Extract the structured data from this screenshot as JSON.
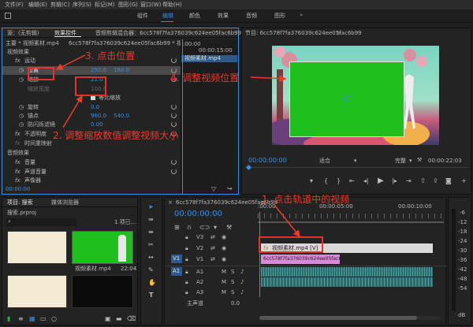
{
  "menu": [
    "文件(F)",
    "编辑(E)",
    "剪辑(C)",
    "序列(S)",
    "标记(M)",
    "图形(G)",
    "窗口(W)",
    "帮助(H)"
  ],
  "workspaces": [
    "组件",
    "编辑",
    "颜色",
    "效果",
    "音频",
    "图形"
  ],
  "effects": {
    "tabs": [
      "源：(无剪辑)",
      "效果控件",
      "音频剪辑混合器：6cc578f7fa376039c624ee05fac6b99"
    ],
    "header_main": "主要 * 视频素材.mp4",
    "header_seq": "6cc578f7fa376039c624ee05fac6b99 * 视...",
    "section_video": "视频效果",
    "motion": "运动",
    "position_label": "位置",
    "position_x": "250.0",
    "position_y": "160.0",
    "scale_label": "缩放",
    "scale_value": "21.0",
    "scale_width_label": "缩放宽度",
    "scale_width_value": "100.0",
    "uniform_label": "等比缩放",
    "rotation_label": "旋转",
    "rotation_value": "0.0",
    "anchor_label": "锚点",
    "anchor_x": "960.0",
    "anchor_y": "540.0",
    "flicker_label": "防闪烁滤镜",
    "flicker_value": "0.00",
    "opacity_label": "不透明度",
    "remap_label": "时间重映射",
    "section_audio": "音频效果",
    "volume_label": "音量",
    "channel_label": "声道音量",
    "panner_label": "声像器",
    "mini_ruler": ":00:00",
    "mini_ruler2": "00:00:15:00",
    "clip_label": "视频素材.mp4",
    "timecode": "00:00:00"
  },
  "program": {
    "title": "节目: 6cc578f7fa376039c624ee05fac6b99",
    "timecode": "00:00:00:00",
    "fit": "适合",
    "quality": "完整",
    "duration": "00:00:22:03"
  },
  "project": {
    "tabs": [
      "项目: 搜索",
      "媒体浏览器"
    ],
    "file": "搜索.prproj",
    "clip_name": "视频素材.mp4",
    "clip_dur": "22:04",
    "count": "1 项已..."
  },
  "timeline": {
    "title": "6cc578f7fa376039c624ee05fac6b99",
    "timecode": "00:00:00:00",
    "ruler": [
      ":00:00",
      "00:00:05:00",
      "00:00:10:00"
    ],
    "tracks_v": [
      "V3",
      "V2",
      "V1"
    ],
    "tracks_a": [
      "A1",
      "A2",
      "A3"
    ],
    "master": "主声道",
    "master_val": "0.0",
    "clip_v2": "视频素材.mp4 [V]",
    "clip_v1": "6cc578f7fa376039c624ee05fac6b99.jpg"
  },
  "meter": [
    "-6",
    "-12",
    "-18",
    "-24",
    "-30",
    "-36",
    "-42",
    "-48",
    "-54",
    "dB"
  ],
  "annotations": {
    "a1": "1. 点击轨道中的视频",
    "a2": "2. 调整缩放数值调整视频大小",
    "a3": "3. 点击位置",
    "a4": "4. 调整视频位置"
  },
  "colors": {
    "accent": "#3b8ee0",
    "annotation": "#f03a2a",
    "green_clip": "#1fbf1f",
    "v2_clip": "#d9d9d9",
    "v1_clip": "#d88ad8",
    "audio_clip": "#2a6a6a"
  }
}
